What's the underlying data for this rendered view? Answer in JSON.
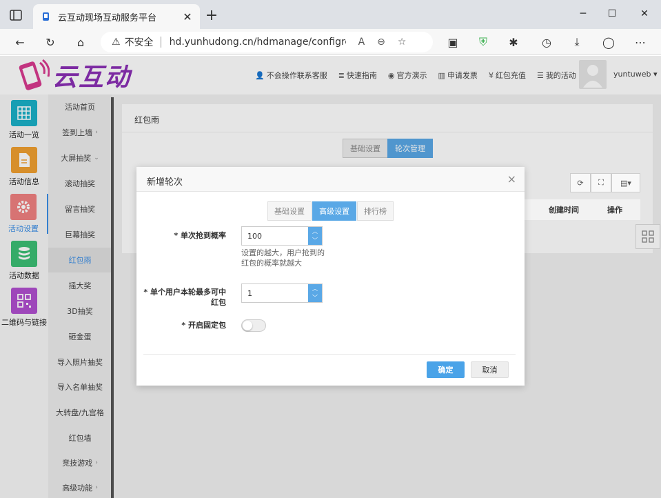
{
  "browser": {
    "tab_title": "云互动现场互动服务平台",
    "insecure_label": "不安全",
    "url": "hd.yunhudong.cn/hdmanage/configred..."
  },
  "header": {
    "logo_text": "云互动",
    "nav": [
      "不会操作联系客服",
      "快速指南",
      "官方演示",
      "申请发票",
      "红包充值",
      "我的活动"
    ],
    "username": "yuntuweb"
  },
  "left_nav": [
    {
      "label": "活动一览",
      "color": "#1ab0c8"
    },
    {
      "label": "活动信息",
      "color": "#f0a030"
    },
    {
      "label": "活动设置",
      "color": "#f08080"
    },
    {
      "label": "活动数据",
      "color": "#3cbf74"
    },
    {
      "label": "二维码与链接",
      "color": "#b050d0"
    }
  ],
  "submenu": [
    "活动首页",
    "签到上墙",
    "大屏抽奖",
    "滚动抽奖",
    "留言抽奖",
    "巨幕抽奖",
    "红包雨",
    "摇大奖",
    "3D抽奖",
    "砸金蛋",
    "导入照片抽奖",
    "导入名单抽奖",
    "大转盘/九宫格",
    "红包墙",
    "竞技游戏",
    "高级功能"
  ],
  "panel": {
    "title": "红包雨",
    "seg_basic": "基础设置",
    "seg_round": "轮次管理",
    "th_created": "创建时间",
    "th_ops": "操作"
  },
  "modal": {
    "title": "新增轮次",
    "tabs": [
      "基础设置",
      "高级设置",
      "排行榜"
    ],
    "field1_label": "* 单次抢到概率",
    "field1_value": "100",
    "field1_hint": "设置的越大，用户抢到的红包的概率就越大",
    "field2_label": "* 单个用户本轮最多可中红包",
    "field2_value": "1",
    "field3_label": "* 开启固定包",
    "ok": "确定",
    "cancel": "取消"
  }
}
